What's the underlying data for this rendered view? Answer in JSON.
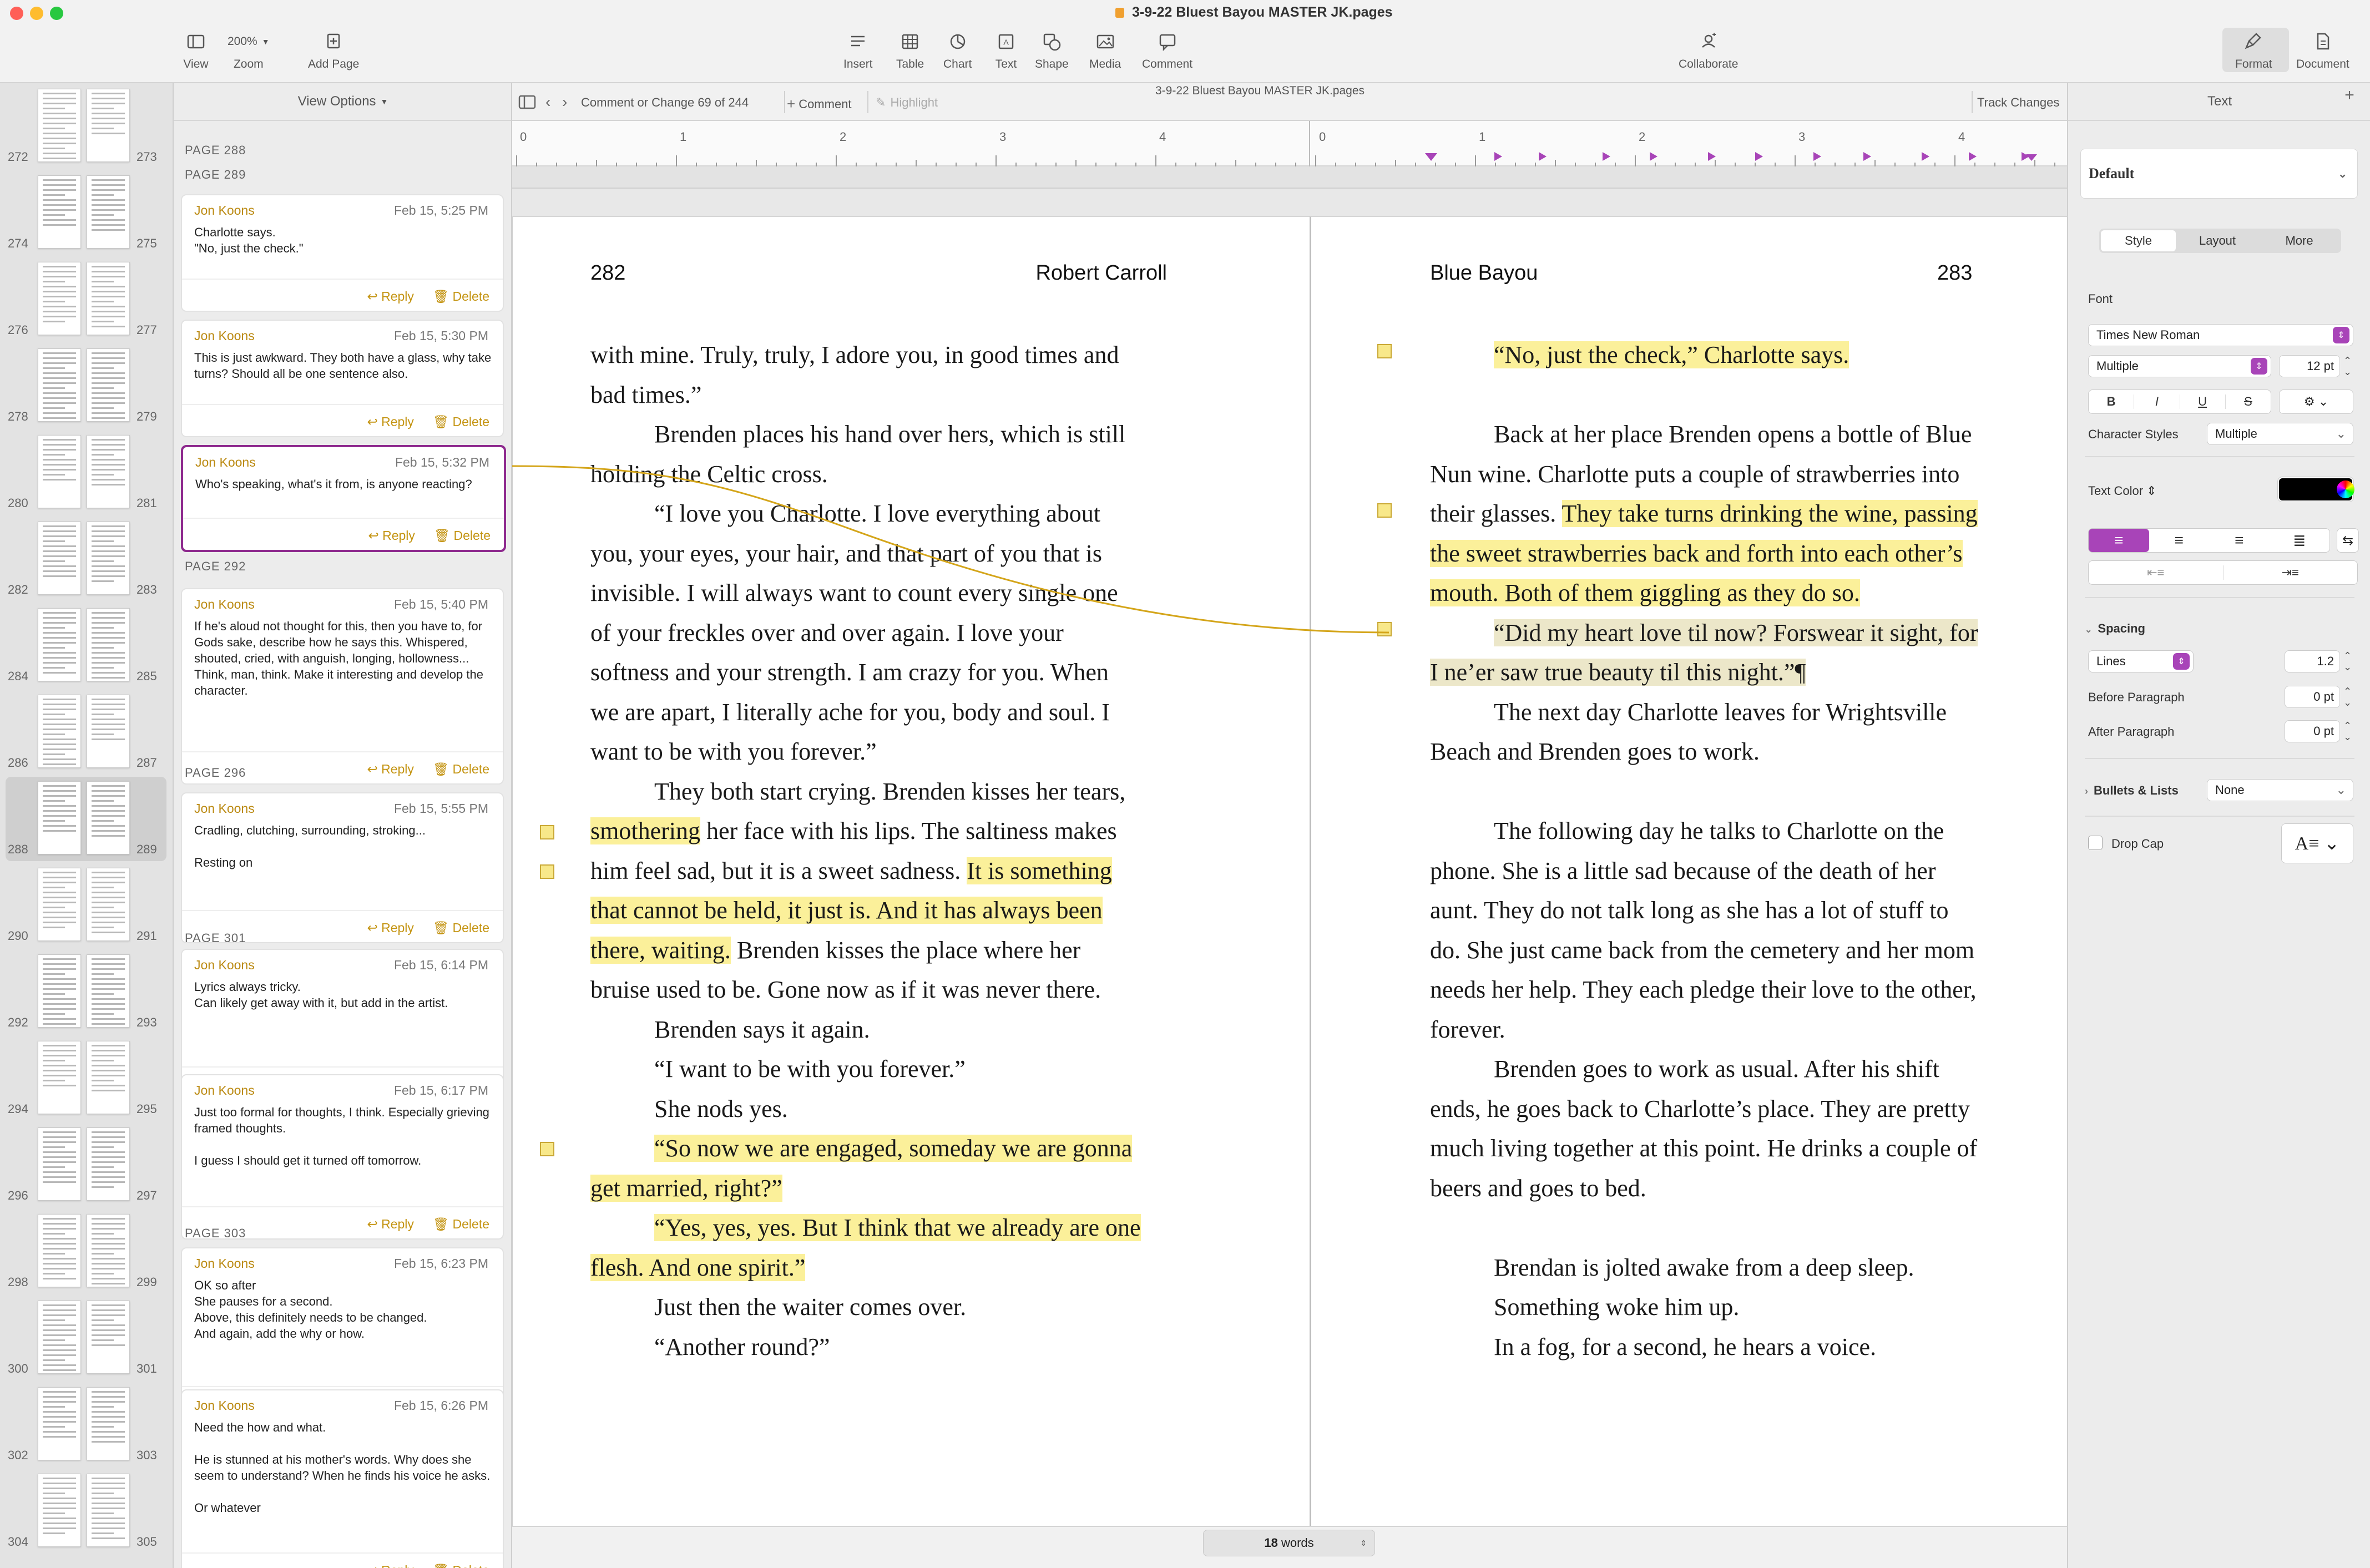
{
  "window": {
    "title": "3-9-22 Bluest Bayou MASTER JK.pages",
    "subtitle": "3-9-22 Bluest Bayou MASTER JK.pages"
  },
  "toolbar": {
    "view": "View",
    "zoom_value": "200%",
    "zoom": "Zoom",
    "add_page": "Add Page",
    "insert": "Insert",
    "table": "Table",
    "chart": "Chart",
    "text": "Text",
    "shape": "Shape",
    "media": "Media",
    "comment": "Comment",
    "collaborate": "Collaborate",
    "format": "Format",
    "document": "Document",
    "plus": "+"
  },
  "thumbnails": [
    {
      "left": "272",
      "right": "273"
    },
    {
      "left": "274",
      "right": "275"
    },
    {
      "left": "276",
      "right": "277"
    },
    {
      "left": "278",
      "right": "279"
    },
    {
      "left": "280",
      "right": "281"
    },
    {
      "left": "282",
      "right": "283"
    },
    {
      "left": "284",
      "right": "285"
    },
    {
      "left": "286",
      "right": "287"
    },
    {
      "left": "288",
      "right": "289"
    },
    {
      "left": "290",
      "right": "291"
    },
    {
      "left": "292",
      "right": "293"
    },
    {
      "left": "294",
      "right": "295"
    },
    {
      "left": "296",
      "right": "297"
    },
    {
      "left": "298",
      "right": "299"
    },
    {
      "left": "300",
      "right": "301"
    },
    {
      "left": "302",
      "right": "303"
    },
    {
      "left": "304",
      "right": "305"
    }
  ],
  "comments_pane": {
    "view_options": "View Options",
    "page_labels": [
      "PAGE 288",
      "PAGE 289",
      "PAGE 292",
      "PAGE 296",
      "PAGE 301",
      "PAGE 303"
    ],
    "reply": "Reply",
    "delete": "Delete",
    "cards": [
      {
        "author": "Jon Koons",
        "date": "Feb 15, 5:25 PM",
        "text": "Charlotte says.\n\"No, just the check.\""
      },
      {
        "author": "Jon Koons",
        "date": "Feb 15, 5:30 PM",
        "text": "This is just awkward. They both have a glass, why take turns? Should all be one sentence also."
      },
      {
        "author": "Jon Koons",
        "date": "Feb 15, 5:32 PM",
        "text": "Who's speaking, what's it from, is anyone reacting?"
      },
      {
        "author": "Jon Koons",
        "date": "Feb 15, 5:40 PM",
        "text": "If he's aloud not thought for this, then you have to, for Gods sake, describe how he says this. Whispered, shouted, cried, with anguish, longing, hollowness...\nThink, man, think. Make it interesting and develop the character."
      },
      {
        "author": "Jon Koons",
        "date": "Feb 15, 5:55 PM",
        "text": "Cradling, clutching, surrounding, stroking...\n\nResting on"
      },
      {
        "author": "Jon Koons",
        "date": "Feb 15, 6:14 PM",
        "text": "Lyrics always tricky.\nCan likely get away with it, but add in the artist."
      },
      {
        "author": "Jon Koons",
        "date": "Feb 15, 6:17 PM",
        "text": "Just too formal for thoughts, I think. Especially grieving framed thoughts.\n\nI guess I should get it turned off tomorrow."
      },
      {
        "author": "Jon Koons",
        "date": "Feb 15, 6:23 PM",
        "text": "OK so after\nShe pauses for a second.\nAbove, this definitely needs to be changed.\nAnd again, add the why or how."
      },
      {
        "author": "Jon Koons",
        "date": "Feb 15, 6:26 PM",
        "text": "Need the how and what.\n\nHe is stunned at his mother's words. Why does she seem to understand? When he finds his voice he asks.\n\nOr whatever"
      }
    ]
  },
  "docbar": {
    "counter": "Comment or Change 69 of 244",
    "comment": "Comment",
    "highlight": "Highlight",
    "track_changes": "Track Changes"
  },
  "ruler": {
    "left_marks": [
      "0",
      "1",
      "2",
      "3",
      "4"
    ],
    "right_marks": [
      "0",
      "1",
      "2",
      "3",
      "4"
    ]
  },
  "left_page": {
    "number": "282",
    "header": "Robert Carroll",
    "lines": [
      "with mine. Truly, truly, I adore you, in good times and",
      "bad times.”",
      "Brenden places his hand over hers, which is still",
      "holding the Celtic cross.",
      "“I love you Charlotte. I love everything about",
      "you, your eyes, your hair, and that part of you that is",
      "invisible. I will always want to count every single one",
      "of your freckles over and over again. I love your",
      "softness and your strength. I am crazy for you. When",
      "we are apart, I literally ache for you, body and soul. I",
      "want to be with you forever.”",
      "They both start crying. Brenden kisses her tears,",
      [
        "smothering",
        " her face with his lips. The saltiness makes"
      ],
      [
        "him feel sad, but it is a sweet sadness. ",
        "It is something"
      ],
      "that cannot be held, it just is. And it has always been",
      [
        "there, waiting.",
        " Brenden kisses the place where her"
      ],
      "bruise used to be. Gone now as if it was never there.",
      "Brenden says it again.",
      "“I want to be with you forever.”",
      "She nods yes.",
      "“So now we are engaged, someday we are gonna",
      "get married, right?”",
      "“Yes, yes, yes. But I think that we already are one",
      "flesh. And one spirit.”",
      "Just then the waiter comes over.",
      "“Another round?”"
    ]
  },
  "right_page": {
    "number": "283",
    "header": "Blue Bayou",
    "lines": [
      "“No, just the check,” Charlotte says.",
      "",
      "Back at her place Brenden opens a bottle of Blue",
      "Nun wine. Charlotte puts a couple of strawberries into",
      [
        "their glasses. ",
        "They take turns drinking the wine, passing"
      ],
      "the sweet strawberries back and forth into each other’s",
      "mouth. Both of them giggling as they do so.",
      "“Did my heart love til now? Forswear it sight, for",
      "I ne’er saw true beauty til this night.”¶",
      "The next day Charlotte leaves for Wrightsville",
      "Beach and Brenden goes to work.",
      "",
      "The following day he talks to Charlotte on the",
      "phone. She is a little sad because of the death of her",
      "aunt. They do not talk long as she has a lot of stuff to",
      "do. She just came back from the cemetery and her mom",
      "needs her help. They each pledge their love to the other,",
      "forever.",
      "Brenden goes to work as usual. After his shift",
      "ends, he goes back to Charlotte’s place. They are pretty",
      "much living together at this point. He drinks a couple of",
      "beers and goes to bed.",
      "",
      "Brendan is jolted awake from a deep sleep.",
      "Something woke him up.",
      "In a fog, for a second, he hears a voice."
    ]
  },
  "status": {
    "word_count": "18",
    "words_label": "words"
  },
  "inspector": {
    "title": "Text",
    "style_name": "Default",
    "tabs": [
      "Style",
      "Layout",
      "More"
    ],
    "font_label": "Font",
    "font_name": "Times New Roman",
    "typeface": "Multiple",
    "font_size": "12 pt",
    "bold": "B",
    "italic": "I",
    "underline": "U",
    "strike": "S",
    "char_styles_label": "Character Styles",
    "char_styles_value": "Multiple",
    "text_color_label": "Text Color",
    "spacing_label": "Spacing",
    "spacing_mode": "Lines",
    "spacing_value": "1.2",
    "before_label": "Before Paragraph",
    "before_value": "0 pt",
    "after_label": "After Paragraph",
    "after_value": "0 pt",
    "bullets_label": "Bullets & Lists",
    "bullets_value": "None",
    "drop_cap_label": "Drop Cap",
    "colors": {
      "accent": "#a844b8",
      "highlight": "#fbf09a",
      "comment_author": "#bb8a12"
    }
  }
}
